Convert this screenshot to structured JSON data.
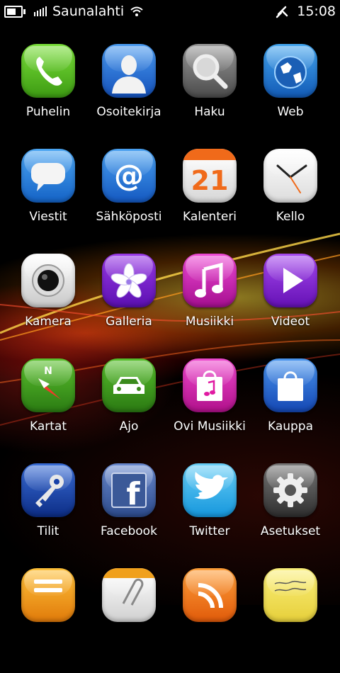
{
  "statusbar": {
    "carrier": "Saunalahti",
    "time": "15:08",
    "icons": [
      "battery-icon",
      "signal-icon",
      "wifi-icon",
      "bluetooth-icon"
    ]
  },
  "apps": [
    {
      "id": "puhelin",
      "label": "Puhelin",
      "icon": "phone-icon",
      "color": "#5bbf1e"
    },
    {
      "id": "osoitekirja",
      "label": "Osoitekirja",
      "icon": "contacts-icon",
      "color": "#1f6fd6"
    },
    {
      "id": "haku",
      "label": "Haku",
      "icon": "search-icon",
      "color": "#6a6a6a"
    },
    {
      "id": "web",
      "label": "Web",
      "icon": "globe-icon",
      "color": "#1e7fd0"
    },
    {
      "id": "viestit",
      "label": "Viestit",
      "icon": "message-icon",
      "color": "#1f80dd"
    },
    {
      "id": "sahkoposti",
      "label": "Sähköposti",
      "icon": "email-icon",
      "color": "#1f78d8"
    },
    {
      "id": "kalenteri",
      "label": "Kalenteri",
      "icon": "calendar-icon",
      "color": "#f0f0f0",
      "calendar_day": "21"
    },
    {
      "id": "kello",
      "label": "Kello",
      "icon": "clock-icon",
      "color": "#f4f4f4"
    },
    {
      "id": "kamera",
      "label": "Kamera",
      "icon": "camera-icon",
      "color": "#e9e9e9"
    },
    {
      "id": "galleria",
      "label": "Galleria",
      "icon": "flower-icon",
      "color": "#7a17c9"
    },
    {
      "id": "musiikki",
      "label": "Musiikki",
      "icon": "music-note-icon",
      "color": "#d21ab7"
    },
    {
      "id": "videot",
      "label": "Videot",
      "icon": "play-icon",
      "color": "#8b1fd3"
    },
    {
      "id": "kartat",
      "label": "Kartat",
      "icon": "compass-icon",
      "color": "#3c9b1c",
      "compass_letter": "N"
    },
    {
      "id": "ajo",
      "label": "Ajo",
      "icon": "car-icon",
      "color": "#36951c"
    },
    {
      "id": "ovi-musiikki",
      "label": "Ovi Musiikki",
      "icon": "music-bag-icon",
      "color": "#e01aa2"
    },
    {
      "id": "kauppa",
      "label": "Kauppa",
      "icon": "shopping-bag-icon",
      "color": "#1f66d4"
    },
    {
      "id": "tilit",
      "label": "Tilit",
      "icon": "key-icon",
      "color": "#1640a8"
    },
    {
      "id": "facebook",
      "label": "Facebook",
      "icon": "facebook-icon",
      "color": "#3b5998",
      "glyph": "f"
    },
    {
      "id": "twitter",
      "label": "Twitter",
      "icon": "twitter-icon",
      "color": "#2aa9e7"
    },
    {
      "id": "asetukset",
      "label": "Asetukset",
      "icon": "gear-icon",
      "color": "#555555"
    },
    {
      "id": "muistio",
      "label": "",
      "icon": "notes-icon",
      "color": "#f0a01c"
    },
    {
      "id": "tiedostot",
      "label": "",
      "icon": "paperclip-icon",
      "color": "#f1f1f1"
    },
    {
      "id": "rss",
      "label": "",
      "icon": "rss-icon",
      "color": "#f07a12"
    },
    {
      "id": "muistilaput",
      "label": "",
      "icon": "sticky-note-icon",
      "color": "#f3e25c"
    }
  ]
}
